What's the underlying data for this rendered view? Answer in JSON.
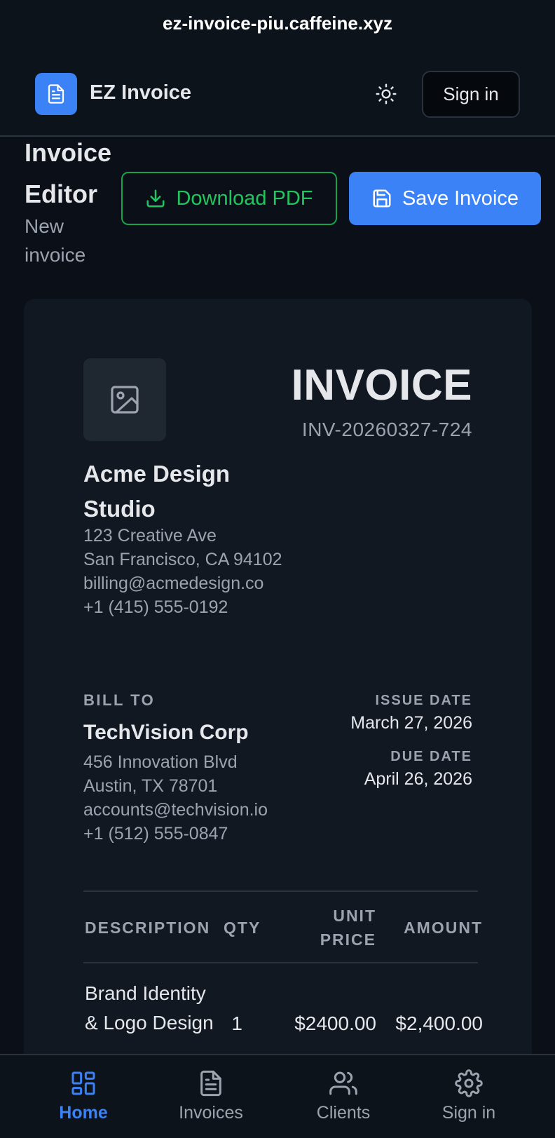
{
  "browser": {
    "url": "ez-invoice-piu.caffeine.xyz"
  },
  "header": {
    "brand": "EZ Invoice",
    "signin_label": "Sign in"
  },
  "page": {
    "title": "Invoice Editor",
    "subtitle": "New invoice",
    "download_label": "Download PDF",
    "save_label": "Save Invoice"
  },
  "invoice": {
    "heading": "INVOICE",
    "number": "INV-20260327-724",
    "company": {
      "name": "Acme Design Studio",
      "address1": "123 Creative Ave",
      "address2": "San Francisco, CA 94102",
      "email": "billing@acmedesign.co",
      "phone": "+1 (415) 555-0192"
    },
    "bill_to_label": "BILL TO",
    "client": {
      "name": "TechVision Corp",
      "address1": "456 Innovation Blvd",
      "address2": "Austin, TX 78701",
      "email": "accounts@techvision.io",
      "phone": "+1 (512) 555-0847"
    },
    "issue_date_label": "ISSUE DATE",
    "issue_date": "March 27, 2026",
    "due_date_label": "DUE DATE",
    "due_date": "April 26, 2026",
    "table": {
      "headers": {
        "description": "DESCRIPTION",
        "qty": "QTY",
        "unit_price": "UNIT PRICE",
        "amount": "AMOUNT"
      },
      "rows": [
        {
          "description": "Brand Identity & Logo Design",
          "qty": "1",
          "unit_price": "$2400.00",
          "amount": "$2,400.00"
        }
      ]
    }
  },
  "bottom_nav": {
    "items": [
      {
        "label": "Home",
        "icon": "dashboard-icon",
        "active": true
      },
      {
        "label": "Invoices",
        "icon": "document-icon",
        "active": false
      },
      {
        "label": "Clients",
        "icon": "users-icon",
        "active": false
      },
      {
        "label": "Sign in",
        "icon": "gear-icon",
        "active": false
      }
    ]
  },
  "colors": {
    "accent": "#3b82f6",
    "success": "#22c55e",
    "background": "#0b1018",
    "card": "#111822"
  }
}
